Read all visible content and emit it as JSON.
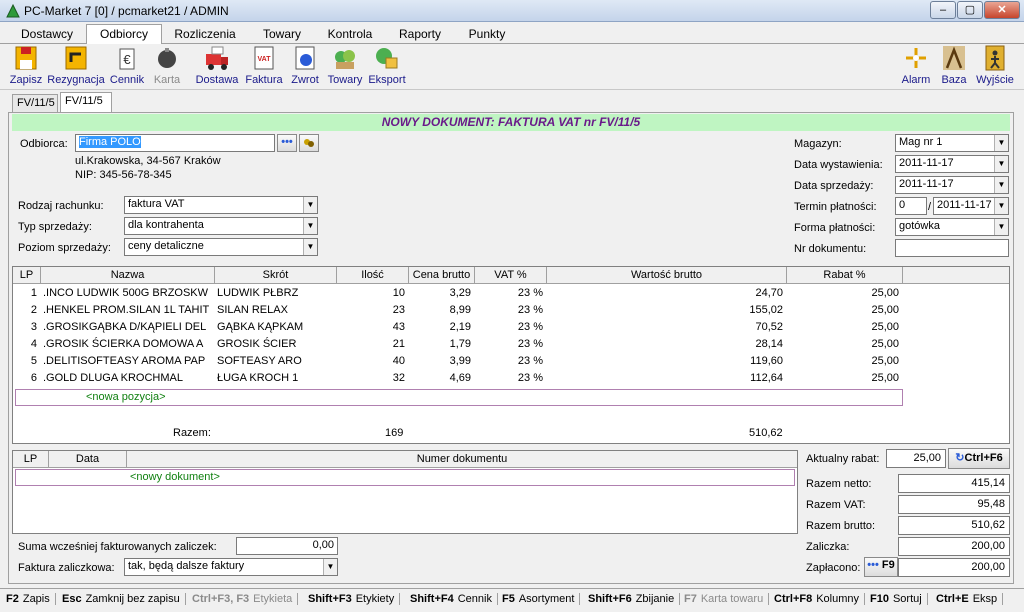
{
  "window": {
    "title": "PC-Market 7 [0] / pcmarket21 / ADMIN"
  },
  "menu": {
    "tabs": [
      "Dostawcy",
      "Odbiorcy",
      "Rozliczenia",
      "Towary",
      "Kontrola",
      "Raporty",
      "Punkty"
    ],
    "active": "Odbiorcy"
  },
  "toolbar": {
    "left": [
      {
        "label": "Zapisz",
        "icon": "save-icon"
      },
      {
        "label": "Rezygnacja",
        "icon": "cancel-icon"
      },
      {
        "label": "Cennik",
        "icon": "price-list-icon"
      },
      {
        "label": "Karta",
        "icon": "card-icon",
        "disabled": true
      },
      {
        "label": "Dostawa",
        "icon": "delivery-truck-icon"
      },
      {
        "label": "Faktura",
        "icon": "invoice-vat-icon"
      },
      {
        "label": "Zwrot",
        "icon": "return-icon"
      },
      {
        "label": "Towary",
        "icon": "goods-icon"
      },
      {
        "label": "Eksport",
        "icon": "export-icon"
      }
    ],
    "right": [
      {
        "label": "Alarm",
        "icon": "alarm-icon"
      },
      {
        "label": "Baza",
        "icon": "database-icon"
      },
      {
        "label": "Wyjście",
        "icon": "exit-icon"
      }
    ]
  },
  "doc_tabs": [
    "FV/11/5",
    "FV/11/5"
  ],
  "banner": "NOWY DOKUMENT: FAKTURA VAT nr FV/11/5",
  "customer": {
    "label": "Odbiorca:",
    "value": "Firma POLO",
    "address": "ul.Krakowska, 34-567 Kraków",
    "nip": "NIP: 345-56-78-345",
    "browse_label": "•••"
  },
  "left_fields": [
    {
      "label": "Rodzaj rachunku:",
      "value": "faktura VAT"
    },
    {
      "label": "Typ sprzedaży:",
      "value": "dla kontrahenta"
    },
    {
      "label": "Poziom sprzedaży:",
      "value": "ceny detaliczne"
    }
  ],
  "right_fields": {
    "magazyn": {
      "label": "Magazyn:",
      "value": "Mag nr 1"
    },
    "data_wyst": {
      "label": "Data wystawienia:",
      "value": "2011-11-17"
    },
    "data_sprz": {
      "label": "Data sprzedaży:",
      "value": "2011-11-17"
    },
    "termin": {
      "label": "Termin płatności:",
      "days": "0",
      "sep": "/",
      "value": "2011-11-17"
    },
    "forma": {
      "label": "Forma płatności:",
      "value": "gotówka"
    },
    "nr_dok": {
      "label": "Nr dokumentu:",
      "value": ""
    }
  },
  "items_table": {
    "headers": [
      "LP",
      "Nazwa",
      "Skrót",
      "Ilość",
      "Cena brutto",
      "VAT %",
      "Wartość brutto",
      "Rabat %"
    ],
    "rows": [
      [
        "1",
        ".INCO  LUDWIK  500G BRZOSKW",
        "LUDWIK PŁBRZ",
        "10",
        "3,29",
        "23 %",
        "24,70",
        "25,00"
      ],
      [
        "2",
        ".HENKEL PROM.SILAN 1L TAHIT",
        "SILAN RELAX",
        "23",
        "8,99",
        "23 %",
        "155,02",
        "25,00"
      ],
      [
        "3",
        ".GROSIKGĄBKA D/KĄPIELI DEL",
        "GĄBKA KĄPKAM",
        "43",
        "2,19",
        "23 %",
        "70,52",
        "25,00"
      ],
      [
        "4",
        ".GROSIK ŚCIERKA DOMOWA A",
        "GROSIK ŚCIER",
        "21",
        "1,79",
        "23 %",
        "28,14",
        "25,00"
      ],
      [
        "5",
        ".DELITISOFTEASY AROMA PAP",
        "SOFTEASY ARO",
        "40",
        "3,99",
        "23 %",
        "119,60",
        "25,00"
      ],
      [
        "6",
        ".GOLD DLUGA KROCHMAL",
        "ŁUGA KROCH 1",
        "32",
        "4,69",
        "23 %",
        "112,64",
        "25,00"
      ]
    ],
    "new_row": "<nowa pozycja>",
    "total_label": "Razem:",
    "total_qty": "169",
    "total_value": "510,62"
  },
  "docs_table": {
    "headers": [
      "LP",
      "Data",
      "Numer dokumentu"
    ],
    "new_row": "<nowy dokument>"
  },
  "advances": {
    "sum_label": "Suma wcześniej fakturowanych zaliczek:",
    "sum_value": "0,00",
    "type_label": "Faktura zaliczkowa:",
    "type_value": "tak, będą dalsze faktury"
  },
  "summary": {
    "rabat_label": "Aktualny rabat:",
    "rabat_value": "25,00",
    "rabat_btn": "Ctrl+F6",
    "netto_label": "Razem netto:",
    "netto_value": "415,14",
    "vat_label": "Razem VAT:",
    "vat_value": "95,48",
    "brutto_label": "Razem brutto:",
    "brutto_value": "510,62",
    "zaliczka_label": "Zaliczka:",
    "zaliczka_value": "200,00",
    "zaplacono_label": "Zapłacono:",
    "zaplacono_btn": "F9",
    "zaplacono_value": "200,00"
  },
  "statusbar": [
    {
      "key": "F2",
      "label": "Zapis"
    },
    {
      "key": "Esc",
      "label": "Zamknij bez zapisu"
    },
    {
      "key": "Ctrl+F3, F3",
      "label": "Etykieta",
      "disabled": true
    },
    {
      "key": "Shift+F3",
      "label": "Etykiety"
    },
    {
      "key": "Shift+F4",
      "label": "Cennik"
    },
    {
      "key": "F5",
      "label": "Asortyment"
    },
    {
      "key": "Shift+F6",
      "label": "Zbijanie"
    },
    {
      "key": "F7",
      "label": "Karta towaru",
      "disabled": true
    },
    {
      "key": "Ctrl+F8",
      "label": "Kolumny"
    },
    {
      "key": "F10",
      "label": "Sortuj"
    },
    {
      "key": "Ctrl+E",
      "label": "Eksp"
    }
  ]
}
